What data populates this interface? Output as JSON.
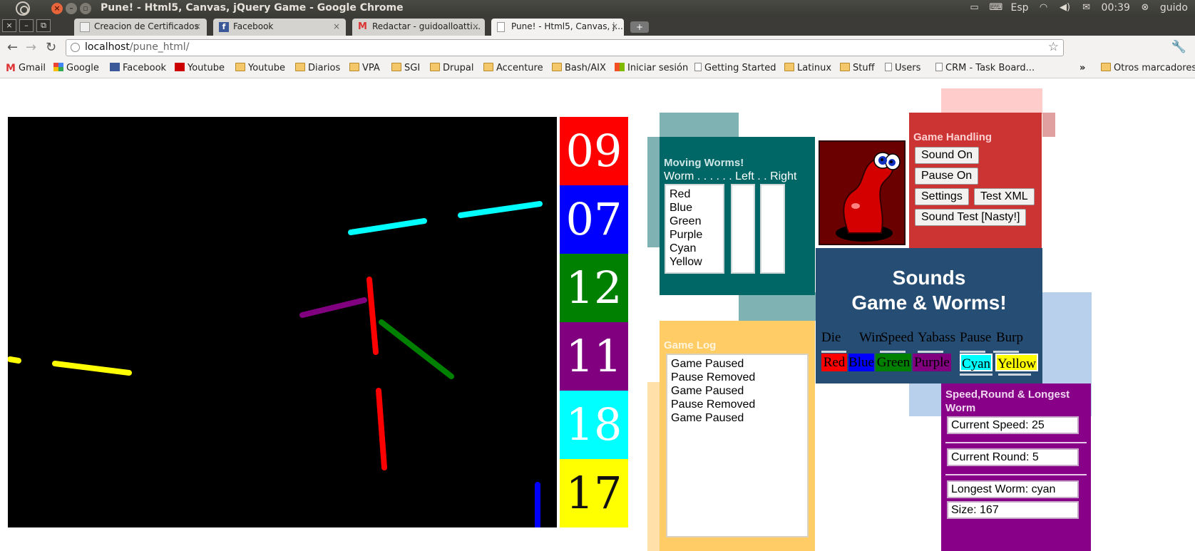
{
  "window": {
    "title": "Pune! - Html5, Canvas, jQuery Game - Google Chrome",
    "tray": {
      "language": "Esp",
      "time": "00:39",
      "user": "guido"
    }
  },
  "tabs": [
    {
      "label": "Creacion de Certificados"
    },
    {
      "label": "Facebook"
    },
    {
      "label": "Redactar - guidoalloatti..."
    },
    {
      "label": "Pune! - Html5, Canvas, j..."
    }
  ],
  "address": {
    "host": "localhost",
    "path": "/pune_html/"
  },
  "bookmarks": [
    {
      "label": "Gmail",
      "icon": "gmail-icon"
    },
    {
      "label": "Google",
      "icon": "google-icon"
    },
    {
      "label": "Facebook",
      "icon": "facebook-icon"
    },
    {
      "label": "Youtube",
      "icon": "youtube-icon"
    },
    {
      "label": "Youtube",
      "icon": "folder-icon"
    },
    {
      "label": "Diarios",
      "icon": "folder-icon"
    },
    {
      "label": "VPA",
      "icon": "folder-icon"
    },
    {
      "label": "SGI",
      "icon": "folder-icon"
    },
    {
      "label": "Drupal",
      "icon": "folder-icon"
    },
    {
      "label": "Accenture",
      "icon": "folder-icon"
    },
    {
      "label": "Bash/AIX",
      "icon": "folder-icon"
    },
    {
      "label": "Iniciar sesión",
      "icon": "windows-icon"
    },
    {
      "label": "Getting Started",
      "icon": "page-icon"
    },
    {
      "label": "Latinux",
      "icon": "folder-icon"
    },
    {
      "label": "Stuff",
      "icon": "folder-icon"
    },
    {
      "label": "Users",
      "icon": "page-icon"
    },
    {
      "label": "CRM - Task Board...",
      "icon": "page-icon"
    }
  ],
  "other_bookmarks": "Otros marcadores",
  "chevron": "»",
  "scores": [
    {
      "value": "09",
      "color": "#ff0000"
    },
    {
      "value": "07",
      "color": "#0000ff"
    },
    {
      "value": "12",
      "color": "#008000"
    },
    {
      "value": "11",
      "color": "#800080"
    },
    {
      "value": "18",
      "color": "#00ffff"
    },
    {
      "value": "17",
      "color": "#ffff00"
    }
  ],
  "moving_worms": {
    "title": "Moving Worms!",
    "header": "Worm . . . . . . Left . . Right",
    "worms": [
      "Red",
      "Blue",
      "Green",
      "Purple",
      "Cyan",
      "Yellow"
    ]
  },
  "game_handling": {
    "title": "Game Handling",
    "buttons": [
      "Sound On",
      "Pause On",
      "Settings",
      "Test XML",
      "Sound Test [Nasty!]"
    ]
  },
  "sounds": {
    "title_line1": "Sounds",
    "title_line2": "Game & Worms!",
    "labels": [
      "Die",
      "Win",
      "Speed",
      "Yabass",
      "Pause",
      "Burp"
    ],
    "colors": [
      {
        "label": "Red",
        "bg": "#ff0000"
      },
      {
        "label": "Blue",
        "bg": "#0000ff"
      },
      {
        "label": "Green",
        "bg": "#008000"
      },
      {
        "label": "Purple",
        "bg": "#800080"
      },
      {
        "label": "Cyan",
        "bg": "#00ffff"
      },
      {
        "label": "Yellow",
        "bg": "#ffff00"
      }
    ]
  },
  "game_log": {
    "title": "Game Log",
    "entries": [
      "Game Paused",
      "Pause Removed",
      "Game Paused",
      "Pause Removed",
      "Game Paused"
    ]
  },
  "stats": {
    "title": "Speed,Round & Longest Worm",
    "current_speed": "Current Speed: 25",
    "current_round": "Current Round: 5",
    "longest_worm": "Longest Worm: cyan",
    "size": "Size: 167"
  }
}
